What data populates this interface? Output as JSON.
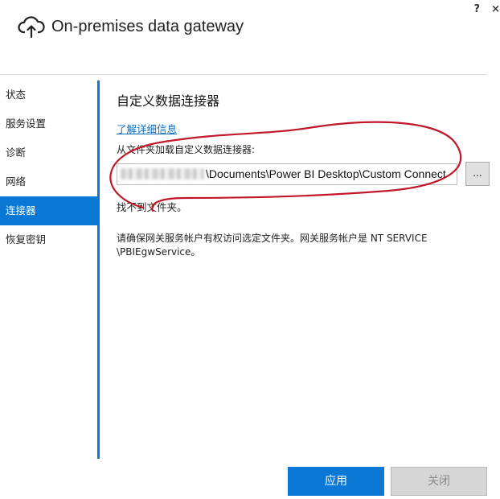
{
  "window": {
    "help_label": "?",
    "close_label": "×"
  },
  "header": {
    "title": "On-premises data gateway",
    "icon": "cloud-upload-icon"
  },
  "sidebar": {
    "items": [
      {
        "label": "状态"
      },
      {
        "label": "服务设置"
      },
      {
        "label": "诊断"
      },
      {
        "label": "网络"
      },
      {
        "label": "连接器",
        "active": true
      },
      {
        "label": "恢复密钥"
      }
    ]
  },
  "connectors": {
    "title": "自定义数据连接器",
    "learn_more": "了解详细信息",
    "folder_label": "从文件夹加载自定义数据连接器:",
    "path_value": "\\Documents\\Power BI Desktop\\Custom Connect",
    "browse_label": "...",
    "status": "找不到文件夹。",
    "info": "请确保网关服务帐户有权访问选定文件夹。网关服务帐户是 NT SERVICE \\PBIEgwService。"
  },
  "footer": {
    "apply_label": "应用",
    "close_label": "关闭"
  },
  "colors": {
    "accent": "#0a78d4",
    "annotation": "#c0182a"
  }
}
